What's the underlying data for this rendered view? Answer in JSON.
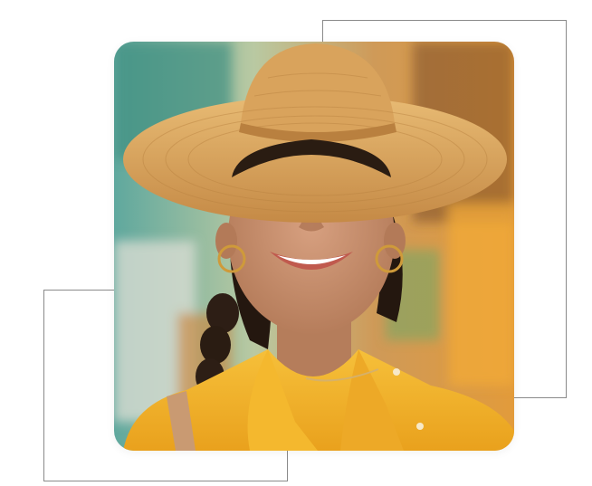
{
  "photo": {
    "subject": "smiling-woman-straw-hat",
    "colors": {
      "hat": "#d9a35c",
      "shirt": "#f2b126",
      "skin": "#c98e6c",
      "hair": "#2a1c17",
      "background_left": "#6bb3a8",
      "background_right": "#e29b3b"
    }
  },
  "frames": {
    "color": "#8a8a8a"
  }
}
